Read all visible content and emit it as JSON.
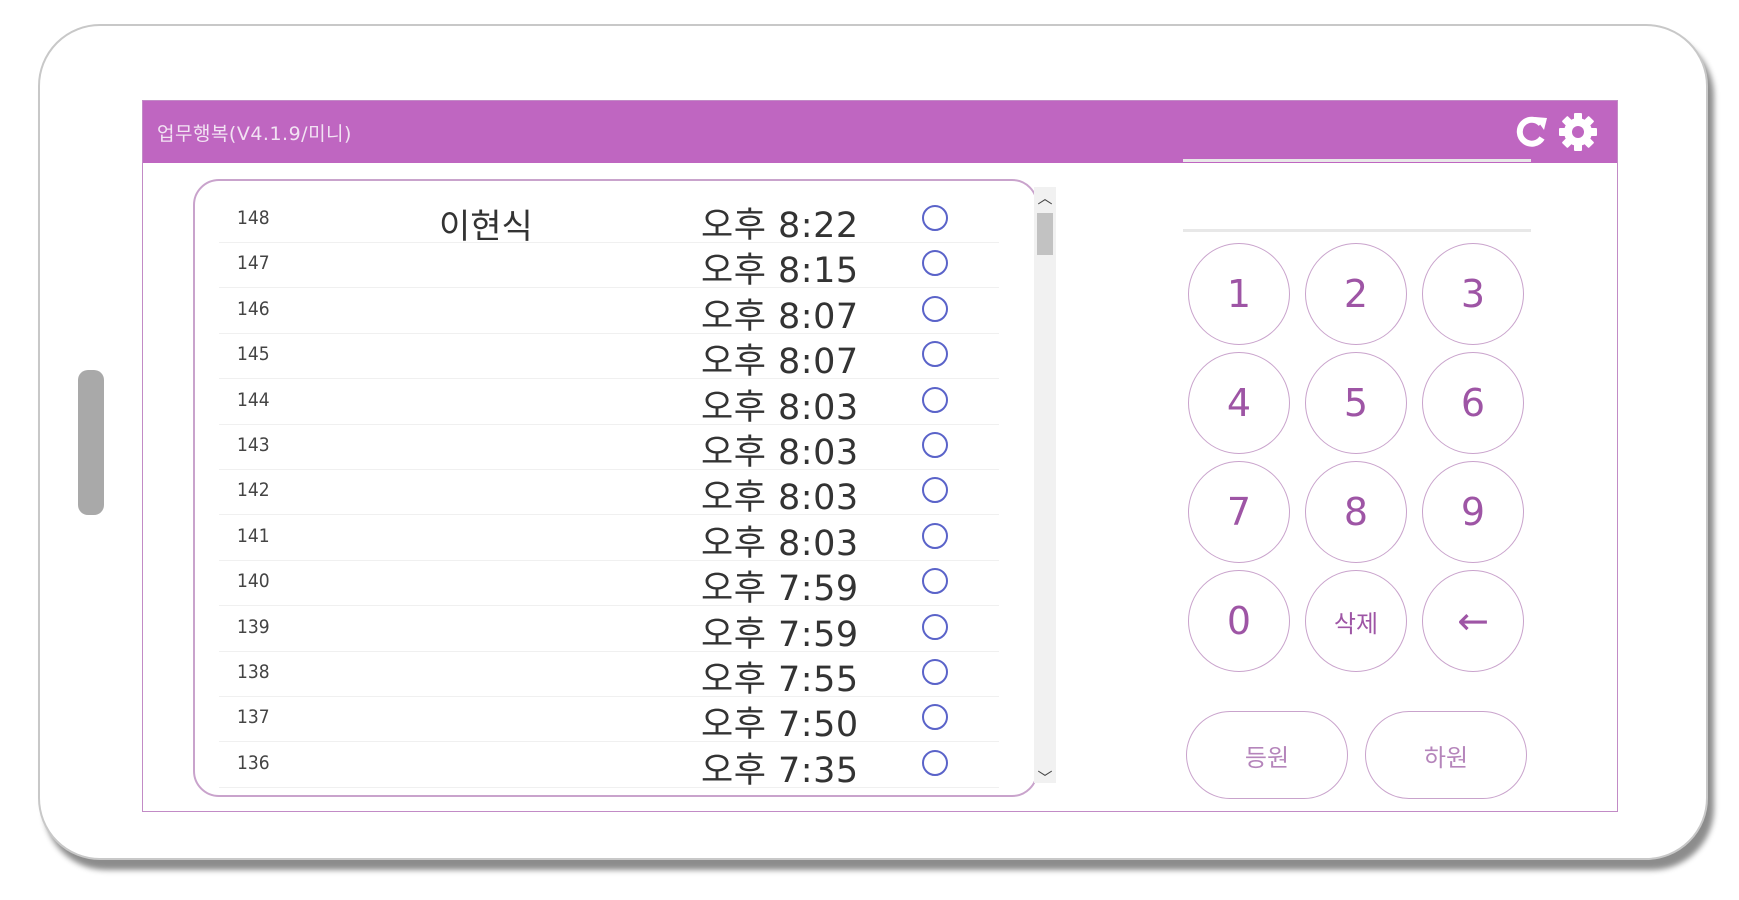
{
  "app": {
    "title": "업무행복(V4.1.9/미니)",
    "accent_color": "#bf66c1",
    "icons": {
      "refresh": "refresh-icon",
      "settings": "gear-icon"
    }
  },
  "records": [
    {
      "num": "148",
      "name": "이현식",
      "time": "오후 8:22"
    },
    {
      "num": "147",
      "name": "",
      "time": "오후 8:15"
    },
    {
      "num": "146",
      "name": "",
      "time": "오후 8:07"
    },
    {
      "num": "145",
      "name": "",
      "time": "오후 8:07"
    },
    {
      "num": "144",
      "name": "",
      "time": "오후 8:03"
    },
    {
      "num": "143",
      "name": "",
      "time": "오후 8:03"
    },
    {
      "num": "142",
      "name": "",
      "time": "오후 8:03"
    },
    {
      "num": "141",
      "name": "",
      "time": "오후 8:03"
    },
    {
      "num": "140",
      "name": "",
      "time": "오후 7:59"
    },
    {
      "num": "139",
      "name": "",
      "time": "오후 7:59"
    },
    {
      "num": "138",
      "name": "",
      "time": "오후 7:55"
    },
    {
      "num": "137",
      "name": "",
      "time": "오후 7:50"
    },
    {
      "num": "136",
      "name": "",
      "time": "오후 7:35"
    }
  ],
  "keypad": {
    "keys": [
      "1",
      "2",
      "3",
      "4",
      "5",
      "6",
      "7",
      "8",
      "9",
      "0",
      "삭제",
      "←"
    ],
    "checkin_label": "등원",
    "checkout_label": "하원"
  }
}
